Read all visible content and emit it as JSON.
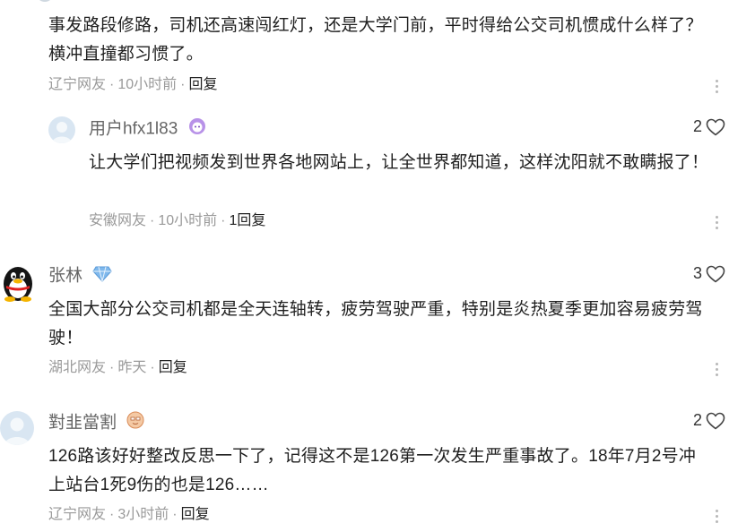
{
  "comments": [
    {
      "text": "事发路段修路，司机还高速闯红灯，还是大学门前，平时得给公交司机惯成什么样了？横冲直撞都习惯了。",
      "location": "辽宁网友",
      "time": "10小时前",
      "reply_label": "回复"
    },
    {
      "username": "用户hfx1l83",
      "likes": "2",
      "text": "让大学们把视频发到世界各地网站上，让全世界都知道，这样沈阳就不敢瞒报了！",
      "location": "安徽网友",
      "time": "10小时前",
      "reply_label": "1回复"
    },
    {
      "username": "张林",
      "likes": "3",
      "text": "全国大部分公交司机都是全天连轴转，疲劳驾驶严重，特别是炎热夏季更加容易疲劳驾驶！",
      "location": "湖北网友",
      "time": "昨天",
      "reply_label": "回复"
    },
    {
      "username": "對韭當割",
      "likes": "2",
      "text": "126路该好好整改反思一下了，记得这不是126第一次发生严重事故了。18年7月2号冲上站台1死9伤的也是126……",
      "location": "辽宁网友",
      "time": "3小时前",
      "reply_label": "回复"
    }
  ],
  "separator": "·",
  "icons": {
    "like": "heart-outline-icon",
    "more": "more-vertical-icon",
    "badge_1": "purple-face-badge-icon",
    "badge_2": "blue-gem-badge-icon",
    "badge_3": "orange-face-badge-icon"
  },
  "colors": {
    "text": "#1f1f1f",
    "meta": "#9a9a9a",
    "username": "#666666"
  }
}
